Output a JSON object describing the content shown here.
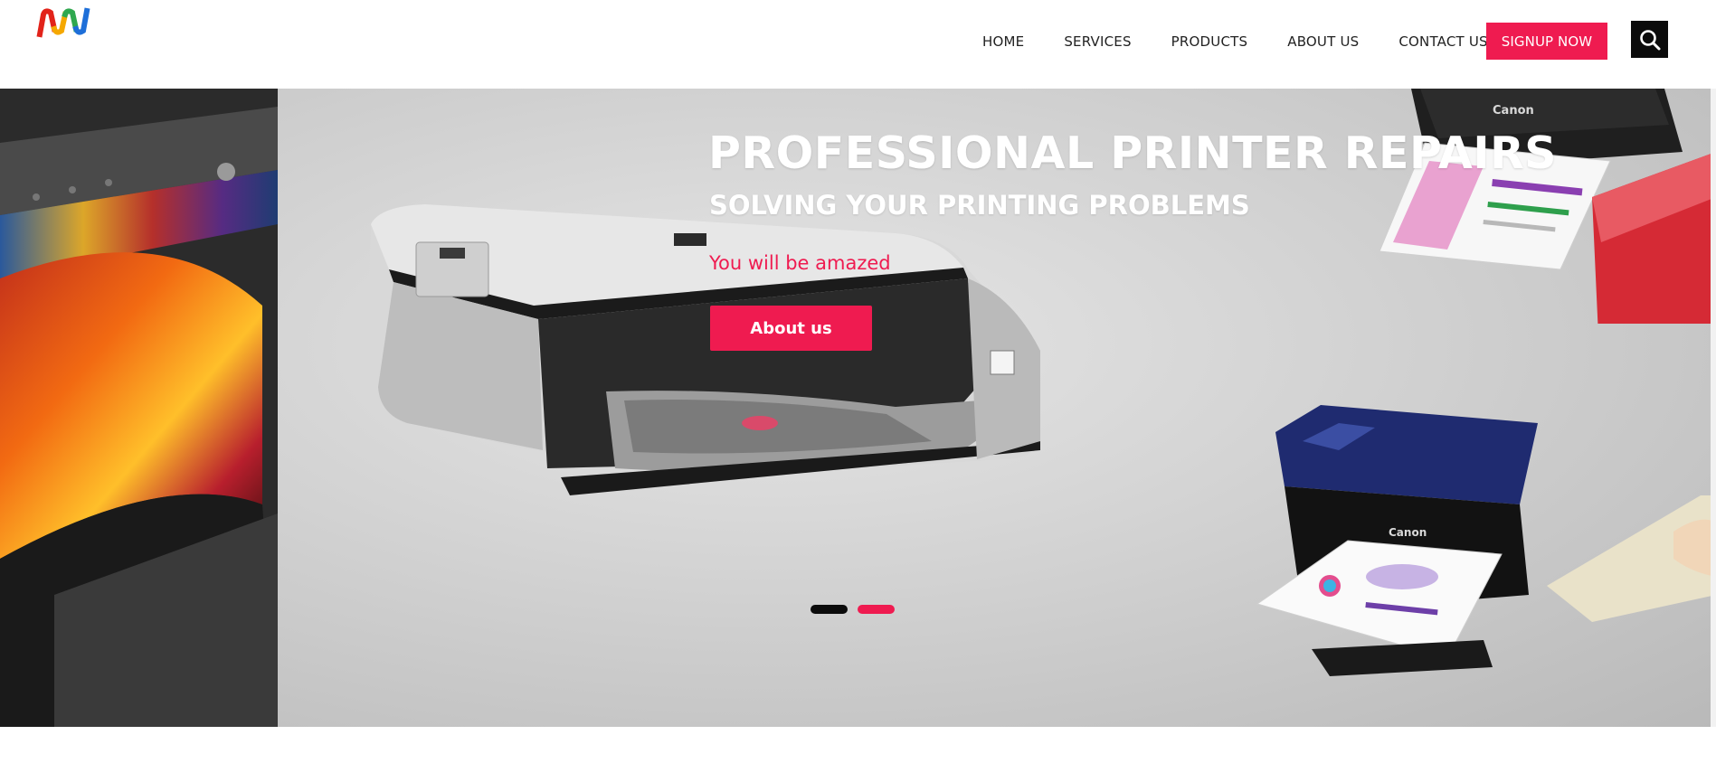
{
  "header": {
    "logo_colors": [
      "#e2231a",
      "#f5a800",
      "#2fa84f",
      "#1e6fd9"
    ],
    "nav": [
      {
        "label": "HOME"
      },
      {
        "label": "SERVICES"
      },
      {
        "label": "PRODUCTS"
      },
      {
        "label": "ABOUT US"
      },
      {
        "label": "CONTACT US"
      }
    ],
    "signup_label": "SIGNUP NOW",
    "search_icon": "search-icon"
  },
  "hero": {
    "title": "PROFESSIONAL PRINTER REPAIRS",
    "subtitle": "SOLVING YOUR PRINTING PROBLEMS",
    "tagline": "You will be amazed",
    "button_label": "About us",
    "slides": {
      "count": 2,
      "active_index": 1
    },
    "printer_brand_label": "Canon"
  },
  "colors": {
    "accent": "#ef1b50",
    "dark": "#0b0b0b",
    "white": "#ffffff"
  }
}
